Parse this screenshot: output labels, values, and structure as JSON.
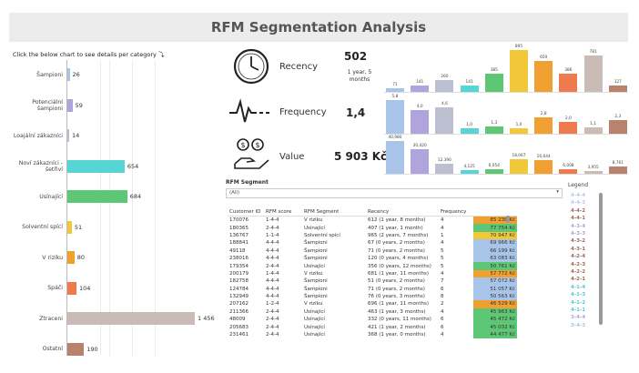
{
  "title": "RFM Segmentation Analysis",
  "instruction": "Click the below chart to see details per category",
  "instruction_icon": "curved-arrow-icon",
  "chart_data": [
    {
      "type": "bar",
      "orientation": "horizontal",
      "categories": [
        "Šampioni",
        "Potenciální šampioni",
        "Loajální zákazníci",
        "Noví zákazníci - šetřiví",
        "Usínající",
        "Solventní spící",
        "V riziku",
        "Spáči",
        "Ztraceni",
        "Ostatní"
      ],
      "values": [
        26,
        59,
        14,
        654,
        684,
        51,
        80,
        104,
        1456,
        190
      ],
      "value_labels": [
        "26",
        "59",
        "14",
        "654",
        "684",
        "51",
        "80",
        "104",
        "1 456",
        "190"
      ],
      "colors": [
        "#a8c4e8",
        "#b0a4dd",
        "#bcbfd0",
        "#57d4d4",
        "#5ec776",
        "#f0c83a",
        "#f0a030",
        "#ee7b4e",
        "#c9bcb7",
        "#b9826c"
      ],
      "xlim": [
        0,
        1456
      ]
    },
    {
      "type": "bar",
      "series": [
        {
          "name": "Recency",
          "values": [
            71,
            141,
            260,
            141,
            385,
            895,
            659,
            386,
            781,
            127
          ]
        }
      ],
      "labels": [
        "71",
        "141",
        "260",
        "141",
        "385",
        "895",
        "659",
        "386",
        "781",
        "127"
      ]
    },
    {
      "type": "bar",
      "series": [
        {
          "name": "Frequency",
          "values": [
            5.8,
            4.0,
            4.6,
            1.0,
            1.3,
            1.0,
            2.8,
            2.0,
            1.1,
            2.3
          ]
        }
      ],
      "labels": [
        "5,8",
        "4,0",
        "4,6",
        "1,0",
        "1,3",
        "1,0",
        "2,8",
        "2,0",
        "1,1",
        "2,3"
      ]
    },
    {
      "type": "bar",
      "series": [
        {
          "name": "Value",
          "values": [
            40980,
            30420,
            12390,
            4125,
            6054,
            18067,
            16644,
            6008,
            3955,
            8761
          ]
        }
      ],
      "labels": [
        "40,980",
        "30,420",
        "12,390",
        "4,125",
        "6,054",
        "18,067",
        "16,644",
        "6,008",
        "3,955",
        "8,761"
      ]
    }
  ],
  "kpis": {
    "recency": {
      "label": "Recency",
      "value": "502",
      "sub": "1 year, 5 months",
      "icon": "clock-icon"
    },
    "frequency": {
      "label": "Frequency",
      "value": "1,4",
      "icon": "pulse-icon"
    },
    "value": {
      "label": "Value",
      "value": "5 903 Kč",
      "icon": "money-hand-icon"
    }
  },
  "segment_filter": {
    "label": "RFM Segment",
    "selected": "(All)"
  },
  "table": {
    "headers": [
      "Customer ID",
      "RFM score",
      "RFM Segment",
      "Recency",
      "Frequency",
      ""
    ],
    "rows": [
      [
        "170076",
        "1-4-4",
        "V riziku",
        "612 (1 year, 8 months)",
        "4",
        "85 238 Kč"
      ],
      [
        "180365",
        "2-4-4",
        "Usínající",
        "407 (1 year, 1 month)",
        "4",
        "77 754 Kč"
      ],
      [
        "136767",
        "1-1-4",
        "Solventní spící",
        "965 (2 years, 7 months)",
        "1",
        "70 947 Kč"
      ],
      [
        "188841",
        "4-4-4",
        "Šampioni",
        "67 (0 years, 2 months)",
        "4",
        "69 966 Kč"
      ],
      [
        "49118",
        "4-4-4",
        "Šampioni",
        "71 (0 years, 2 months)",
        "5",
        "66 199 Kč"
      ],
      [
        "238016",
        "4-4-4",
        "Šampioni",
        "120 (0 years, 4 months)",
        "5",
        "63 083 Kč"
      ],
      [
        "179354",
        "2-4-4",
        "Usínající",
        "356 (0 years, 12 months)",
        "5",
        "50 761 Kč"
      ],
      [
        "200179",
        "1-4-4",
        "V riziku",
        "681 (1 year, 11 months)",
        "4",
        "57 772 Kč"
      ],
      [
        "182758",
        "4-4-4",
        "Šampioni",
        "51 (0 years, 2 months)",
        "7",
        "57 072 Kč"
      ],
      [
        "124784",
        "4-4-4",
        "Šampioni",
        "71 (0 years, 2 months)",
        "6",
        "51 057 Kč"
      ],
      [
        "132949",
        "4-4-4",
        "Šampioni",
        "76 (0 years, 3 months)",
        "8",
        "50 563 Kč"
      ],
      [
        "207162",
        "1-2-4",
        "V riziku",
        "696 (1 year, 11 months)",
        "2",
        "46 529 Kč"
      ],
      [
        "211366",
        "2-4-4",
        "Usínající",
        "463 (1 year, 3 months)",
        "4",
        "45 963 Kč"
      ],
      [
        "48009",
        "2-4-4",
        "Usínající",
        "332 (0 years, 11 months)",
        "6",
        "45 472 Kč"
      ],
      [
        "205683",
        "2-4-4",
        "Usínající",
        "421 (1 year, 2 months)",
        "6",
        "45 032 Kč"
      ],
      [
        "231461",
        "2-4-4",
        "Usínající",
        "368 (1 year, 0 months)",
        "4",
        "44 477 Kč"
      ]
    ],
    "row_colors": [
      "#f0a030",
      "#5ec776",
      "#f0c83a",
      "#a8c4e8",
      "#a8c4e8",
      "#a8c4e8",
      "#5ec776",
      "#f0a030",
      "#a8c4e8",
      "#a8c4e8",
      "#a8c4e8",
      "#f0a030",
      "#5ec776",
      "#5ec776",
      "#5ec776",
      "#5ec776"
    ]
  },
  "legend": {
    "title": "Legend",
    "items": [
      "4-4-4",
      "4-4-3",
      "4-4-2",
      "4-4-1",
      "4-3-4",
      "4-3-3",
      "4-3-2",
      "4-3-1",
      "4-2-4",
      "4-2-3",
      "4-2-2",
      "4-2-1",
      "4-1-4",
      "4-1-3",
      "4-1-2",
      "4-1-1",
      "3-4-4",
      "3-4-3"
    ],
    "colors": [
      "#b8c8e8",
      "#b8c8e8",
      "#9c6b57",
      "#9c6b57",
      "#b0a4dd",
      "#b0a4dd",
      "#9c6b57",
      "#9c6b57",
      "#9c6b57",
      "#9c6b57",
      "#9c6b57",
      "#9c6b57",
      "#57c9c9",
      "#57c9c9",
      "#57c9c9",
      "#57c9c9",
      "#b0a4dd",
      "#a8c4e8"
    ]
  }
}
